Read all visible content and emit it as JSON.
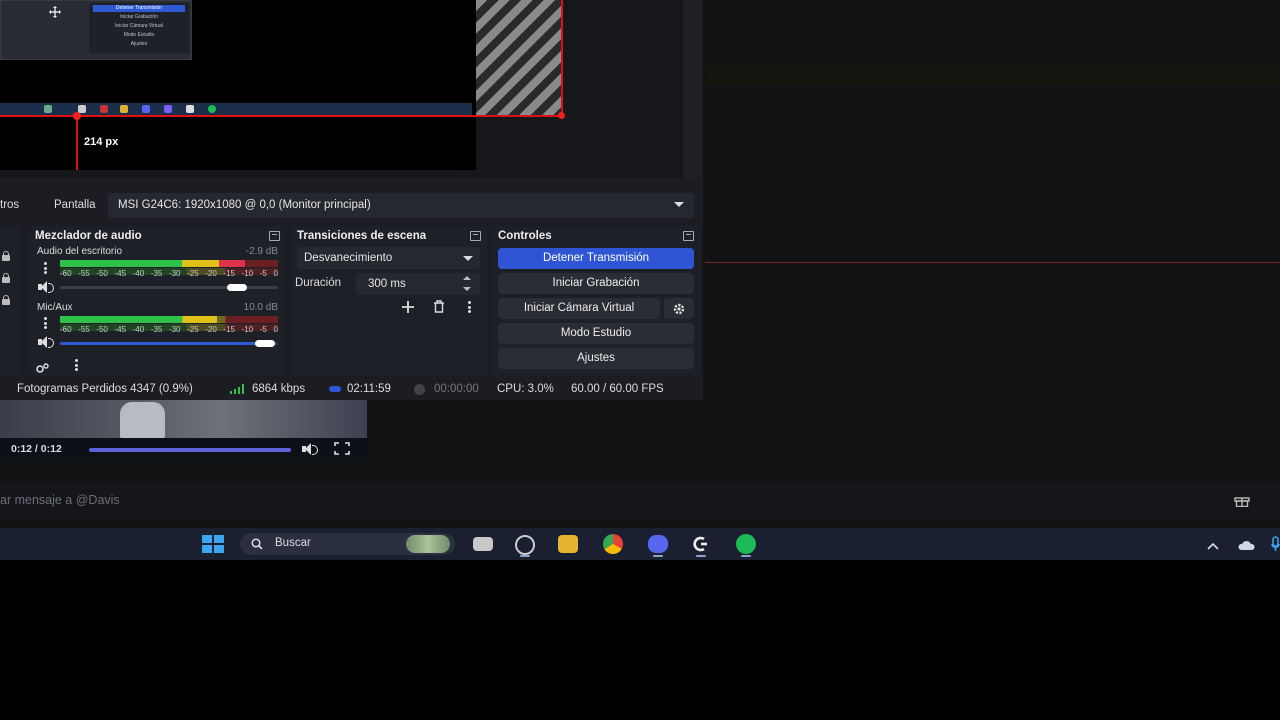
{
  "obs": {
    "preview": {
      "measure_label": "214 px",
      "mini_menu": [
        "Detener Transmisión",
        "Iniciar Grabación",
        "Iniciar Cámara Virtual",
        "Modo Estudio",
        "Ajustes"
      ]
    },
    "properties": {
      "filters_label": "tros",
      "display_label": "Pantalla",
      "display_value": "MSI G24C6: 1920x1080 @ 0,0 (Monitor principal)"
    },
    "mixer": {
      "title": "Mezclador de audio",
      "channels": [
        {
          "name": "Audio del escritorio",
          "db": "-2.9 dB",
          "level": 0.85,
          "volume": 0.82
        },
        {
          "name": "Mic/Aux",
          "db": "10.0 dB",
          "level": 0.72,
          "volume": 0.95
        }
      ],
      "ticks": [
        "-60",
        "-55",
        "-50",
        "-45",
        "-40",
        "-35",
        "-30",
        "-25",
        "-20",
        "-15",
        "-10",
        "-5",
        "0"
      ]
    },
    "transitions": {
      "title": "Transiciones de escena",
      "selected": "Desvanecimiento",
      "duration_label": "Duración",
      "duration_value": "300 ms"
    },
    "controls": {
      "title": "Controles",
      "buttons": [
        "Detener Transmisión",
        "Iniciar Grabación",
        "Iniciar Cámara Virtual",
        "Modo Estudio",
        "Ajustes"
      ]
    },
    "status": {
      "dropped_frames": "Fotogramas Perdidos 4347 (0.9%)",
      "bitrate": "6864 kbps",
      "stream_time": "02:11:59",
      "rec_time": "00:00:00",
      "cpu": "CPU: 3.0%",
      "fps": "60.00 / 60.00 FPS"
    }
  },
  "video": {
    "time": "0:12 / 0:12",
    "progress": 1.0
  },
  "chat": {
    "placeholder": "ar mensaje a @Davis"
  },
  "taskbar": {
    "search_placeholder": "Buscar"
  },
  "colors": {
    "accent": "#2f55d4",
    "red_guide": "#dd1111",
    "meter_green": "#2ec24a"
  }
}
